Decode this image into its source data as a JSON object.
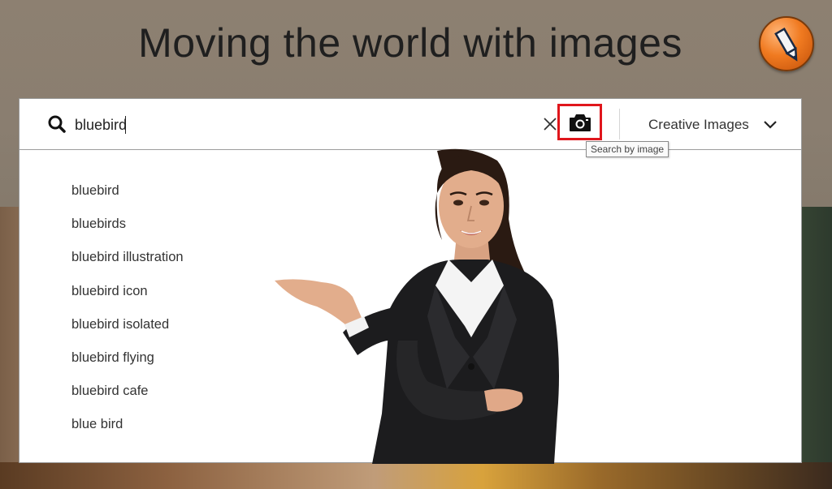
{
  "hero": {
    "title": "Moving the world with images"
  },
  "search": {
    "query": "bluebird",
    "category": "Creative Images",
    "tooltip": "Search by image"
  },
  "suggestions": [
    "bluebird",
    "bluebirds",
    "bluebird illustration",
    "bluebird icon",
    "bluebird isolated",
    "bluebird flying",
    "bluebird cafe",
    "blue bird"
  ],
  "icons": {
    "search": "search-icon",
    "clear": "close-icon",
    "camera": "camera-icon",
    "dropdown": "chevron-down-icon",
    "edit": "pencil-icon"
  },
  "colors": {
    "highlight": "#e0161c",
    "hero_bg": "#8d8071",
    "badge": "#f07a20"
  }
}
